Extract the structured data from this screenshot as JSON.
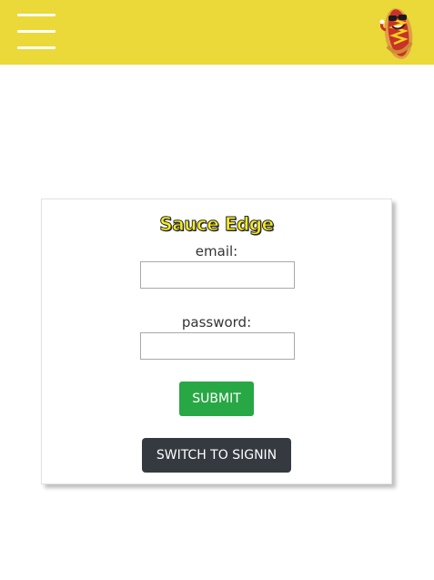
{
  "header": {
    "menu_icon": "hamburger-menu-icon",
    "logo_icon": "hot-dog-mascot-logo",
    "bar_color": "#ebd839"
  },
  "form": {
    "brand": "Sauce Edge",
    "email_label": "email:",
    "email_value": "",
    "password_label": "password:",
    "password_value": "",
    "submit_label": "SUBMIT",
    "switch_label": "SWITCH TO SIGNIN",
    "colors": {
      "submit": "#28a745",
      "switch": "#343a40",
      "brand": "#f7ec1f"
    }
  }
}
